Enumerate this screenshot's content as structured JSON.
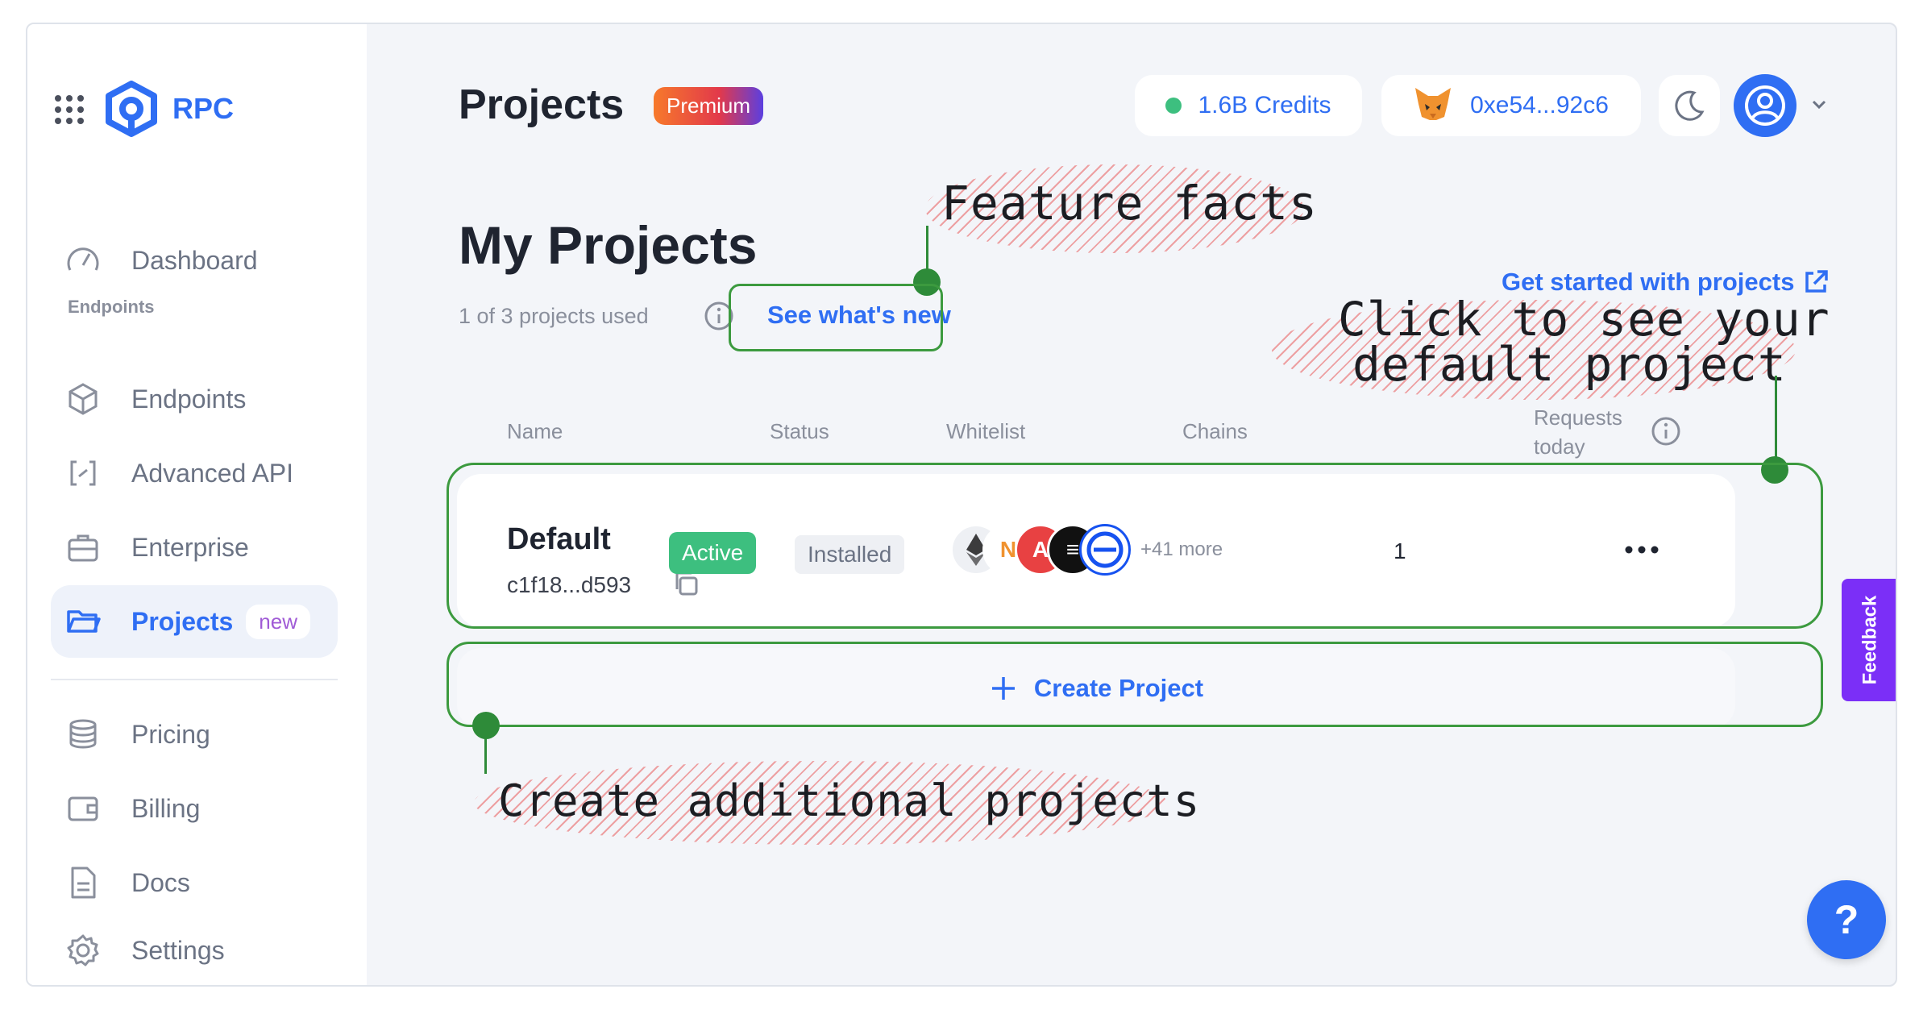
{
  "sidebar": {
    "brand": "RPC",
    "section_endpoints": "Endpoints",
    "items": [
      {
        "label": "Dashboard",
        "icon": "gauge-icon"
      },
      {
        "label": "Endpoints",
        "icon": "cube-icon"
      },
      {
        "label": "Advanced API",
        "icon": "api-brackets-icon"
      },
      {
        "label": "Enterprise",
        "icon": "briefcase-icon"
      },
      {
        "label": "Projects",
        "icon": "folder-icon",
        "badge": "new",
        "active": true
      },
      {
        "label": "Pricing",
        "icon": "coins-icon"
      },
      {
        "label": "Billing",
        "icon": "wallet-icon"
      },
      {
        "label": "Docs",
        "icon": "document-icon"
      },
      {
        "label": "Settings",
        "icon": "gear-icon"
      }
    ]
  },
  "header": {
    "title": "Projects",
    "plan_badge": "Premium",
    "credits": "1.6B Credits",
    "wallet": "0xe54...92c6"
  },
  "projects": {
    "heading": "My Projects",
    "usage": "1 of 3 projects used",
    "whats_new": "See what's new",
    "get_started": "Get started with projects",
    "columns": {
      "name": "Name",
      "status": "Status",
      "whitelist": "Whitelist",
      "chains": "Chains",
      "requests_line1": "Requests",
      "requests_line2": "today"
    },
    "rows": [
      {
        "name": "Default",
        "id": "c1f18...d593",
        "status": "Active",
        "whitelist": "Installed",
        "chains_more": "+41 more",
        "requests": "1"
      }
    ],
    "create_label": "Create Project"
  },
  "annotations": {
    "feature_facts": "Feature facts",
    "click_line1": "Click to see your",
    "click_line2": "default project",
    "create_more": "Create additional projects"
  },
  "feedback_label": "Feedback",
  "help_label": "?",
  "colors": {
    "accent": "#2f6ef3",
    "active_green": "#3dbf7f",
    "annotation_green": "#2e8b39",
    "feedback_purple": "#7b2ff7"
  }
}
